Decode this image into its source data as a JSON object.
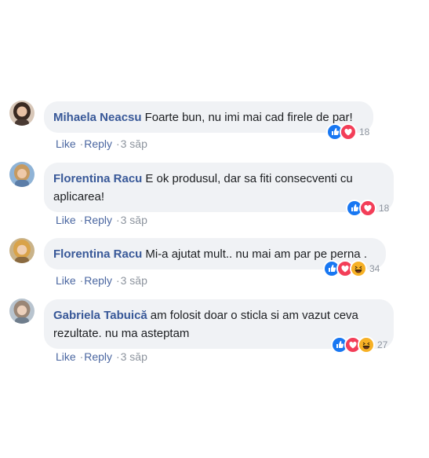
{
  "colors": {
    "author": "#385898",
    "bubble": "#f0f2f5",
    "like": "#1877f2",
    "love": "#f33e58",
    "haha": "#f7b125",
    "meta": "#8d949e"
  },
  "comments": [
    {
      "author": "Mihaela Neacsu",
      "text": "Foarte bun, nu imi mai cad firele de par!",
      "actions": {
        "like": "Like",
        "reply": "Reply",
        "dot": "·",
        "time": "3 săp"
      },
      "reactions": [
        "like-icon",
        "love-icon"
      ],
      "reaction_count": "18"
    },
    {
      "author": "Florentina Racu",
      "text": "E ok produsul, dar sa fiti consecventi cu aplicarea!",
      "actions": {
        "like": "Like",
        "reply": "Reply",
        "dot": "·",
        "time": "3 săp"
      },
      "reactions": [
        "like-icon",
        "love-icon"
      ],
      "reaction_count": "18"
    },
    {
      "author": "Florentina Racu",
      "text": "Mi-a ajutat mult.. nu mai am par pe perna .",
      "actions": {
        "like": "Like",
        "reply": "Reply",
        "dot": "·",
        "time": "3 săp"
      },
      "reactions": [
        "like-icon",
        "love-icon",
        "haha-icon"
      ],
      "reaction_count": "34"
    },
    {
      "author": "Gabriela Tabuică",
      "text": "am folosit doar o sticla si am vazut ceva rezultate. nu ma asteptam",
      "actions": {
        "like": "Like",
        "reply": "Reply",
        "dot": "·",
        "time": "3 săp"
      },
      "reactions": [
        "like-icon",
        "love-icon",
        "haha-icon"
      ],
      "reaction_count": "27"
    }
  ]
}
